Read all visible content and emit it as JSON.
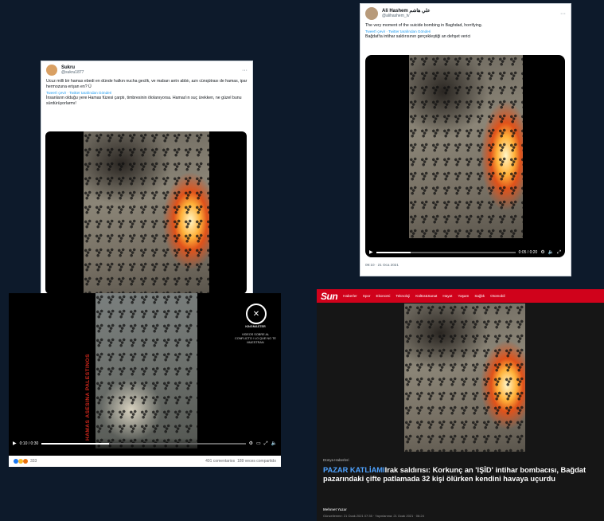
{
  "tweet_left": {
    "name": "Sukru",
    "handle": "@sukru1877",
    "text": "Ucuz milli bir hamas ebedi en dünde halkın nucha gecilk, ve mabarı antrı abbiı, azn cünqütrası de hamas, ipar hermozuna erişan en? Ü",
    "translate": "Tweet'i çevir · Twitter tarafından Gönderi",
    "text_tr": "İnsanların olduğu yere Hamas füzesi çarptı, timbresinin ölolanıyorsa. Hamas'ın suç ürekken, ne güzel bunu sürdürüyorlarmı!"
  },
  "tweet_right": {
    "name": "Ali Hashem علي هاشم",
    "handle": "@alihashem_tv",
    "text": "The very moment of the suicide bombing in Baghdad, horrifying.",
    "translate": "Tweet'i çevir · Twitter tarafından Gönderi",
    "text_tr": "Bağdat'ta intihar saldırısının gerçekleştiği an dehşet verici",
    "video_time": "0:05 / 0:20",
    "timestamp": "09:10 · 21 Oca 2021"
  },
  "fb_video": {
    "side_text": "HAMAS ASESINA PALESTINOS",
    "brand": "KINGMASTER",
    "brand_sub": "VIDEOS SOBRE AL CONFLICTO / LO QUE NO TE MUESTRAN",
    "time": "0:10 / 0:30",
    "reactions": "333",
    "comments": "491 comentarios",
    "shares": "189 veces compartido"
  },
  "sun": {
    "logo": "Sun",
    "nav": [
      "Haberler",
      "Spor",
      "Ekonomi",
      "Teknoloji",
      "Kültür&Sanat",
      "Hayat",
      "Yaşam",
      "Sağlık",
      "Otomobil"
    ],
    "kicker": "Dünya Haberleri",
    "headline_accent": "PAZAR KATLİAMI",
    "headline_rest": "Irak saldırısı: Korkunç an 'IŞİD' intihar bombacısı, Bağdat pazarındaki çifte patlamada 32 kişi ölürken kendini havaya uçurdu",
    "author": "Mehmet Yazar",
    "byline": "Güncellenme: 21 Ocak 2021 07:35 · Yayınlanma: 21 Ocak 2021 · 06:24"
  },
  "colors": {
    "background": "#0d1a2b",
    "sun_red": "#d0021b",
    "accent_blue": "#4fa3ff",
    "side_red": "#d3281d"
  }
}
